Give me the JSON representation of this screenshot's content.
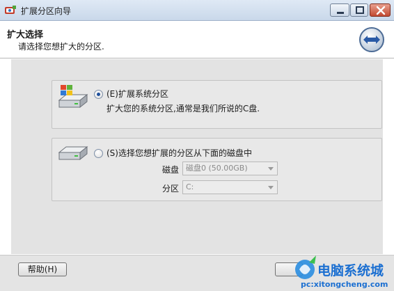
{
  "window": {
    "title": "扩展分区向导"
  },
  "header": {
    "title": "扩大选择",
    "subtitle": "请选择您想扩大的分区."
  },
  "options": {
    "system": {
      "label": "(E)扩展系统分区",
      "description": "扩大您的系统分区,通常是我们所说的C盘.",
      "checked": true
    },
    "choose": {
      "label": "(S)选择您想扩展的分区从下面的磁盘中",
      "checked": false,
      "disk_label": "磁盘",
      "disk_value": "磁盘0 (50.00GB)",
      "partition_label": "分区",
      "partition_value": "C:"
    }
  },
  "footer": {
    "help_label": "帮助(H)"
  },
  "watermark": {
    "brand": "电脑系统城",
    "url": "pc:xitongcheng.com"
  },
  "colors": {
    "titlebar": "#c9d8ea",
    "close_button": "#c24a32",
    "content_bg": "#e3e3e3",
    "radio_dot": "#1e4f9c",
    "watermark_blue": "#1b6fd1"
  }
}
